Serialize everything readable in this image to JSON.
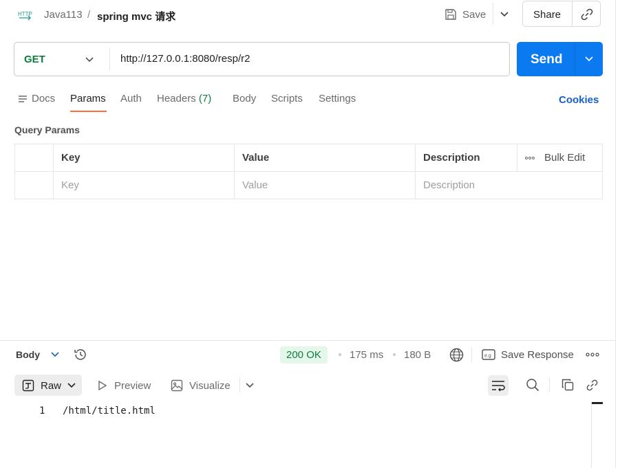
{
  "header": {
    "method_badge": "HTTP",
    "breadcrumb_parent": "Java113",
    "breadcrumb_sep": "/",
    "title": "spring mvc 请求",
    "save_label": "Save",
    "share_label": "Share"
  },
  "request": {
    "method": "GET",
    "url": "http://127.0.0.1:8080/resp/r2",
    "send_label": "Send"
  },
  "tabs": [
    {
      "label": "Docs"
    },
    {
      "label": "Params",
      "active": true
    },
    {
      "label": "Auth"
    },
    {
      "label": "Headers"
    },
    {
      "label": "Body"
    },
    {
      "label": "Scripts"
    },
    {
      "label": "Settings"
    }
  ],
  "headers_count": "(7)",
  "cookies_label": "Cookies",
  "query_params": {
    "title": "Query Params",
    "columns": [
      "Key",
      "Value",
      "Description"
    ],
    "bulk_edit": "Bulk Edit",
    "placeholders": [
      "Key",
      "Value",
      "Description"
    ]
  },
  "response": {
    "body_label": "Body",
    "status": "200 OK",
    "time": "175 ms",
    "size": "180 B",
    "save_response": "Save Response",
    "views": {
      "raw": "Raw",
      "preview": "Preview",
      "visualize": "Visualize"
    },
    "lines": [
      {
        "no": "1",
        "text": "/html/title.html"
      }
    ]
  },
  "colors": {
    "send": "#0b7af0",
    "method_get": "#0c7d3d",
    "active_tab_underline": "#ff6c37",
    "status_ok_bg": "#e5f6ea",
    "cookies": "#1760c8"
  },
  "icons": [
    "http-icon",
    "save-icon",
    "chevron-down-icon",
    "link-icon",
    "docs-icon",
    "history-icon",
    "globe-icon",
    "example-icon",
    "more-icon",
    "raw-icon",
    "play-icon",
    "image-icon",
    "wrap-icon",
    "search-icon",
    "copy-icon"
  ]
}
